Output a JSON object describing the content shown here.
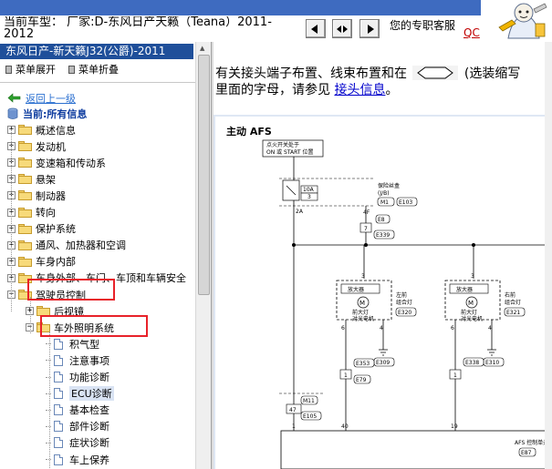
{
  "header": {
    "model_line1": "当前车型：  厂家:D-东风日产天籁（Teana）2011-",
    "model_line2": "2012",
    "customer_service": "您的专职客服",
    "qc_link": "QC",
    "nav_buttons": [
      "prev-section",
      "expand-both",
      "next-section"
    ],
    "band_color": "#3e6bc0"
  },
  "left_panel": {
    "title": "东风日产-新天籁J32(公爵)-2011",
    "expand_menu": "菜单展开",
    "collapse_menu": "菜单折叠",
    "back_link": "返回上一级",
    "current_label": "当前:所有信息",
    "tree": [
      {
        "label": "概述信息",
        "type": "folder",
        "level": 0,
        "expander": "+"
      },
      {
        "label": "发动机",
        "type": "folder",
        "level": 0,
        "expander": "+"
      },
      {
        "label": "变速箱和传动系",
        "type": "folder",
        "level": 0,
        "expander": "+"
      },
      {
        "label": "悬架",
        "type": "folder",
        "level": 0,
        "expander": "+"
      },
      {
        "label": "制动器",
        "type": "folder",
        "level": 0,
        "expander": "+"
      },
      {
        "label": "转向",
        "type": "folder",
        "level": 0,
        "expander": "+"
      },
      {
        "label": "保护系统",
        "type": "folder",
        "level": 0,
        "expander": "+"
      },
      {
        "label": "通风、加热器和空调",
        "type": "folder",
        "level": 0,
        "expander": "+"
      },
      {
        "label": "车身内部",
        "type": "folder",
        "level": 0,
        "expander": "+"
      },
      {
        "label": "车身外部、车门、车顶和车辆安全",
        "type": "folder",
        "level": 0,
        "expander": "+"
      },
      {
        "label": "驾驶员控制",
        "type": "folder",
        "level": 0,
        "expander": "−"
      },
      {
        "label": "后视镜",
        "type": "folder",
        "level": 1,
        "expander": "+"
      },
      {
        "label": "车外照明系统",
        "type": "folder",
        "level": 1,
        "expander": "−"
      },
      {
        "label": "积气型",
        "type": "doc",
        "level": 2
      },
      {
        "label": "注意事项",
        "type": "doc",
        "level": 2
      },
      {
        "label": "功能诊断",
        "type": "doc",
        "level": 2
      },
      {
        "label": "ECU诊断",
        "type": "doc",
        "level": 2,
        "selected": true
      },
      {
        "label": "基本检查",
        "type": "doc",
        "level": 2
      },
      {
        "label": "部件诊断",
        "type": "doc",
        "level": 2
      },
      {
        "label": "症状诊断",
        "type": "doc",
        "level": 2
      },
      {
        "label": "车上保养",
        "type": "doc",
        "level": 2
      }
    ],
    "highlight_color": "#e8222a",
    "selected_color": "#d9e3f3"
  },
  "content": {
    "intro_part1": "有关接头端子布置、线束布置和在",
    "intro_part2": "(选装缩写",
    "intro_line2_part1": "里面的字母，请参见",
    "intro_link": "接头信息",
    "intro_line2_end": "。"
  },
  "diagram": {
    "title": "主动 AFS",
    "ignition_note_1": "点火开关处于",
    "ignition_note_2": "ON 或 START 位置",
    "fuse_amp": "10A",
    "fuse_no": "3",
    "fuse_box_1": "保险丝盒",
    "fuse_box_2": "(J/B)",
    "conn_m1": "M1",
    "conn_e103": "E103",
    "pin_2a": "2A",
    "pin_4f": "4F",
    "conn_e8": "E8",
    "pin_7": "7",
    "conn_e339": "E339",
    "amp_label": "放大器",
    "motor_mark": "M",
    "left_lamp_1": "左前",
    "left_lamp_2": "组合灯",
    "right_lamp_1": "右前",
    "right_lamp_2": "组合灯",
    "motor_1": "前大灯",
    "motor_2": "对光电机",
    "conn_e320": "E320",
    "conn_e321": "E321",
    "pin_3": "3",
    "pin_6": "6",
    "pin_4": "4",
    "pin_1": "1",
    "conn_e353": "E353",
    "conn_e79": "E79",
    "conn_e309": "E309",
    "conn_e338": "E338",
    "conn_e310": "E310",
    "conn_m11": "M11",
    "pin_47": "47",
    "conn_e105": "E105",
    "pin_40": "40",
    "pin_19": "19",
    "afs_unit": "AFS 控制单元",
    "conn_e87": "E87"
  }
}
